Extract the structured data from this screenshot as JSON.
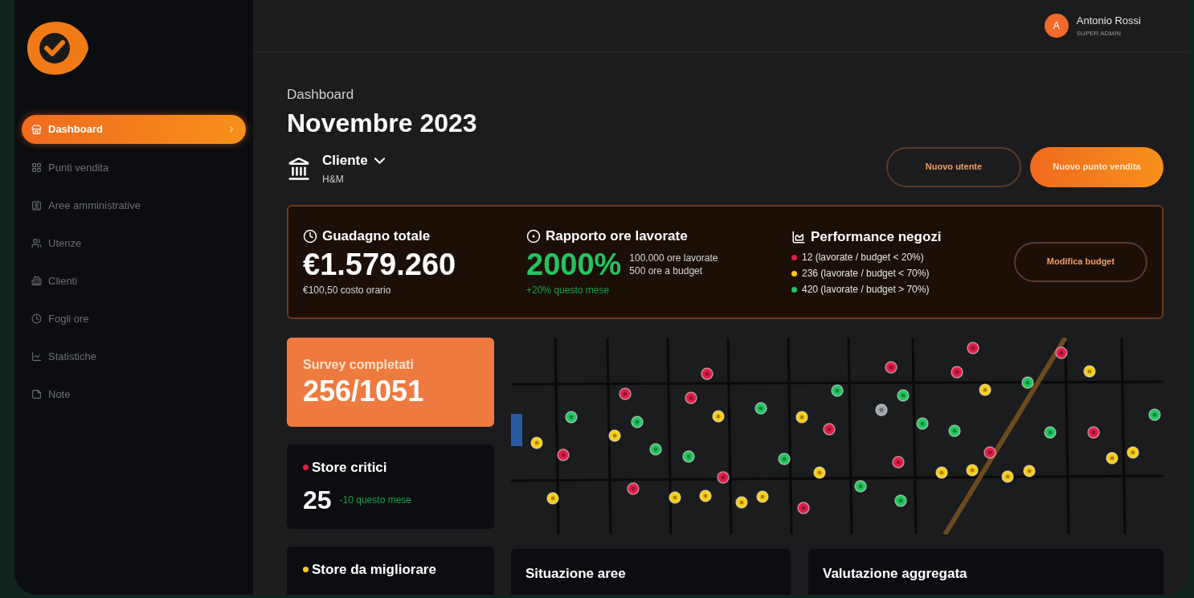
{
  "user": {
    "initial": "A",
    "name": "Antonio Rossi",
    "role": "SUPER ADMIN"
  },
  "sidebar": {
    "items": [
      {
        "label": "Dashboard",
        "selected": true
      },
      {
        "label": "Punti vendita",
        "selected": false
      },
      {
        "label": "Aree amministrative",
        "selected": false
      },
      {
        "label": "Utenze",
        "selected": false
      },
      {
        "label": "Clienti",
        "selected": false
      },
      {
        "label": "Fogli ore",
        "selected": false
      },
      {
        "label": "Statistiche",
        "selected": false
      },
      {
        "label": "Note",
        "selected": false
      }
    ]
  },
  "page": {
    "breadcrumb": "Dashboard",
    "title": "Novembre 2023"
  },
  "client_picker": {
    "label": "Cliente",
    "value": "H&M"
  },
  "buttons": [
    {
      "label": "Nuovo utente",
      "kind": "outline"
    },
    {
      "label": "Nuovo punto vendita",
      "kind": "primary"
    }
  ],
  "summary": {
    "earnings": {
      "title": "Guadagno totale",
      "value": "€1.579.260",
      "note": "€100,50 costo orario"
    },
    "ratio": {
      "title": "Rapporto ore lavorate",
      "value": "2000%",
      "details": [
        "100.000 ore lavorate",
        "500 ore a budget"
      ],
      "trend": "+20% questo mese"
    },
    "performance": {
      "title": "Performance negozi",
      "legend": [
        {
          "text": "12 (lavorate / budget < 20%)",
          "color": "#e11d48"
        },
        {
          "text": "236 (lavorate / budget < 70%)",
          "color": "#facc15"
        },
        {
          "text": "420 (lavorate / budget > 70%)",
          "color": "#22c55e"
        }
      ]
    },
    "button": "Modifica budget"
  },
  "cards": [
    {
      "kind": "survey",
      "title": "Survey completati",
      "value": "256/1051"
    },
    {
      "kind": "status",
      "title": "Store critici",
      "color": "#e11d48",
      "value": "25",
      "trend": "-10 questo mese"
    },
    {
      "kind": "status",
      "title": "Store da migliorare",
      "color": "#facc15"
    }
  ],
  "panels": [
    {
      "title": "Situazione aree"
    },
    {
      "title": "Valutazione aggregata"
    }
  ]
}
